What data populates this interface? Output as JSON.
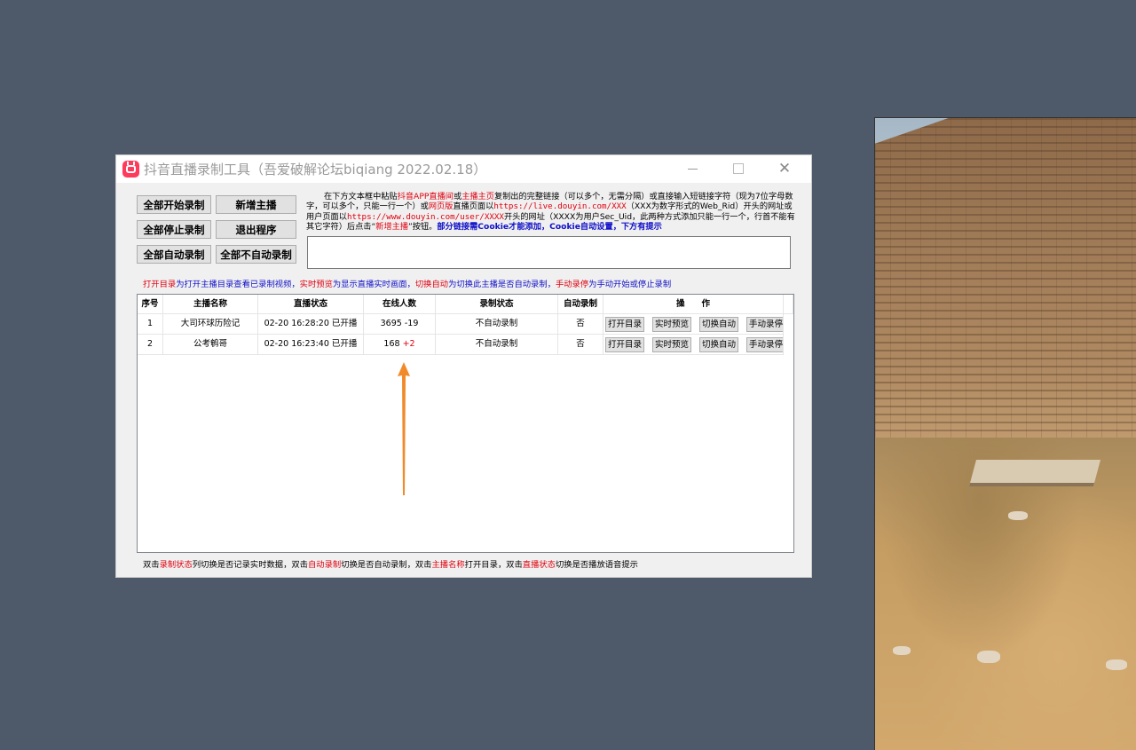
{
  "window": {
    "title": "抖音直播录制工具（吾爱破解论坛biqiang 2022.02.18）",
    "minimize_icon": "minimize-icon",
    "maximize_icon": "maximize-icon",
    "close_icon": "close-icon"
  },
  "buttons": {
    "start_all": "全部开始录制",
    "add_streamer": "新增主播",
    "stop_all": "全部停止录制",
    "exit": "退出程序",
    "auto_all": "全部自动录制",
    "no_auto_all": "全部不自动录制"
  },
  "instructions": {
    "p1": "在下方文本框中粘贴",
    "p2": "抖音APP直播间",
    "p3": "或",
    "p4": "主播主页",
    "p5": "复制出的完整链接（可以多个，无需分隔）或直接输入短链接字符（现为7位字母数字，可以多个，只能一行一个）或",
    "p6": "网页版",
    "p7": "直播页面以",
    "p8": "https://live.douyin.com/XXX",
    "p9": "（XXX为数字形式的Web_Rid）开头的网址或用户页面以",
    "p10": "https://www.douyin.com/user/XXXX",
    "p11": "开头的网址（XXXX为用户Sec_Uid，此两种方式添加只能一行一个，行首不能有其它字符）后点击“",
    "p12": "新增主播",
    "p13": "”按钮。",
    "p14": "部分链接需Cookie才能添加，Cookie自动设置，下方有提示"
  },
  "link_input": {
    "value": ""
  },
  "top_hint": {
    "a": "打开目录",
    "b": "为打开主播目录查看已录制视频，",
    "c": "实时预览",
    "d": "为显示直播实时画面，",
    "e": "切换自动",
    "f": "为切换此主播是否自动录制，",
    "g": "手动录停",
    "h": "为手动开始或停止录制"
  },
  "table": {
    "headers": [
      "序号",
      "主播名称",
      "直播状态",
      "在线人数",
      "录制状态",
      "自动录制",
      "操　　作"
    ],
    "op_labels": [
      "打开目录",
      "实时预览",
      "切换自动",
      "手动录停"
    ],
    "rows": [
      {
        "index": "1",
        "name": "大司环球历险记",
        "status": "02-20 16:28:20 已开播",
        "online": "3695",
        "delta": "-19",
        "record": "不自动录制",
        "auto": "否"
      },
      {
        "index": "2",
        "name": "公考鹌哥",
        "status": "02-20 16:23:40 已开播",
        "online": "168",
        "delta": "+2",
        "record": "不自动录制",
        "auto": "否"
      }
    ]
  },
  "bottom_hint": {
    "a": "双击",
    "b": "录制状态",
    "c": "列切换是否记录实时数据，双击",
    "d": "自动录制",
    "e": "切换是否自动录制，双击",
    "f": "主播名称",
    "g": "打开目录，双击",
    "h": "直播状态",
    "i": "切换是否播放语音提示"
  },
  "colors": {
    "desktop": "#4e5a69",
    "accent_red": "#e0000f",
    "accent_blue": "#1010c8",
    "arrow": "#f08a2a",
    "app_icon": "#ff3b5c"
  }
}
